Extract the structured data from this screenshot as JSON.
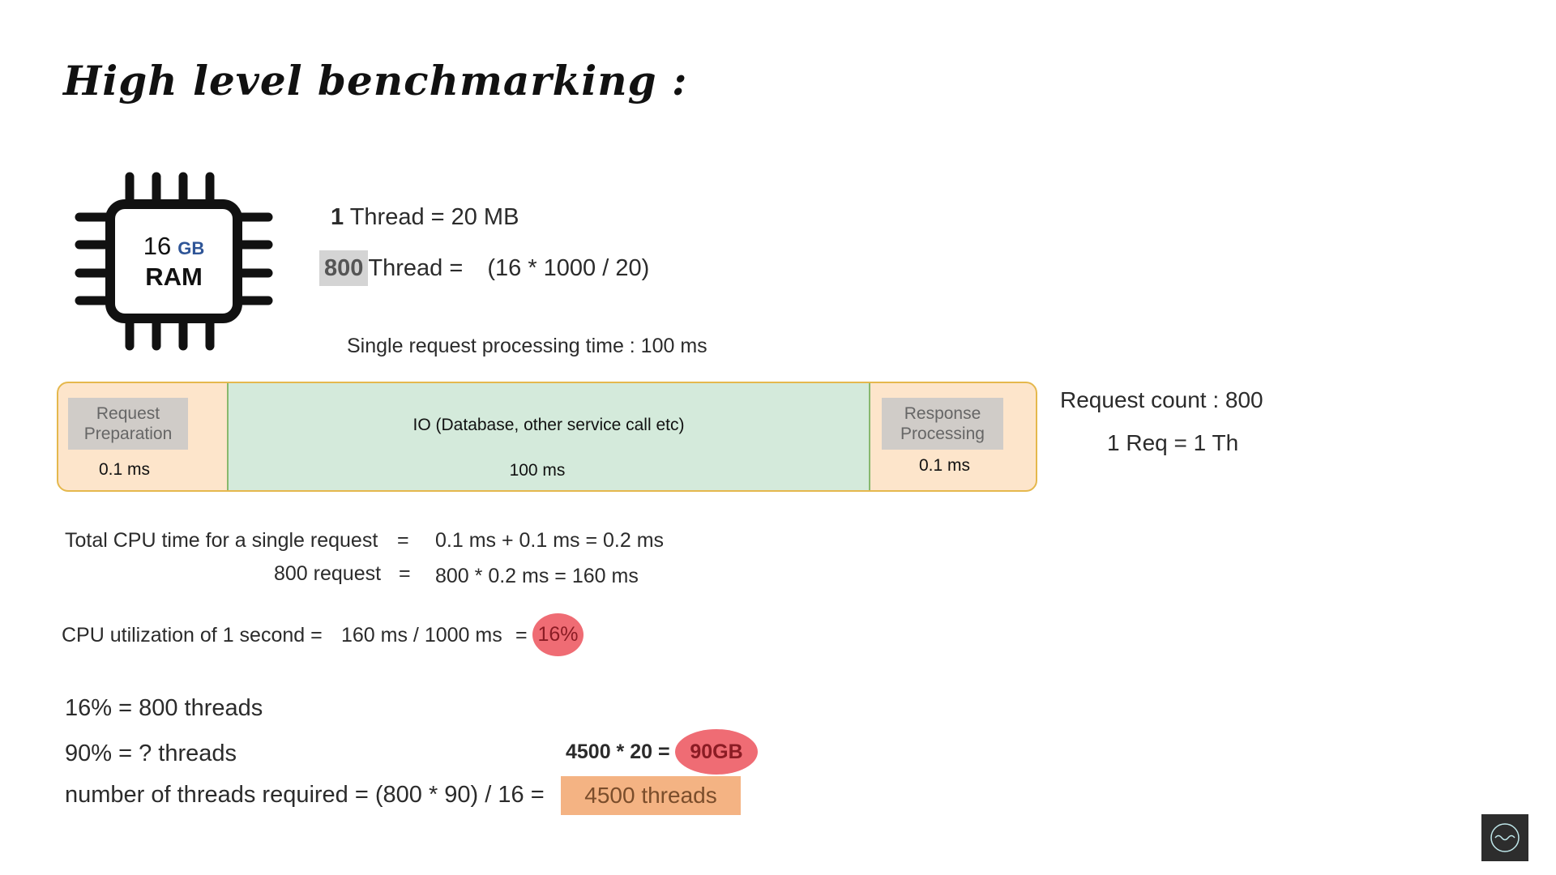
{
  "title": "High level benchmarking :",
  "chip": {
    "size": "16",
    "unit": "GB",
    "label": "RAM"
  },
  "thread_eq": {
    "count": "1",
    "text": "Thread = 20 MB"
  },
  "thread800": {
    "count": "800",
    "text": "Thread =",
    "formula": "(16 * 1000 / 20)"
  },
  "single_req_time": "Single request processing time : 100 ms",
  "timeline": {
    "prep_label": "Request Preparation",
    "prep_time": "0.1 ms",
    "io_label": "IO (Database, other service call etc)",
    "io_time": "100 ms",
    "resp_label": "Response Processing",
    "resp_time": "0.1 ms"
  },
  "request_count": "Request count : 800",
  "req_th": "1 Req = 1 Th",
  "cpu_total": {
    "label": "Total CPU time for a single request",
    "eq": "=",
    "value": "0.1 ms + 0.1 ms = 0.2 ms"
  },
  "cpu_800": {
    "label": "800 request",
    "eq": "=",
    "value": "800 * 0.2 ms = 160 ms"
  },
  "cpu_util": {
    "label": "CPU utilization of 1 second =",
    "value": "160 ms / 1000 ms",
    "eq": "=",
    "result": "16%"
  },
  "threads_16": "16% = 800 threads",
  "threads_90": "90% = ? threads",
  "mem_calc": {
    "text": "4500 * 20 =",
    "result": "90GB"
  },
  "threads_required": {
    "text": "number of threads required = (800 * 90) / 16 =",
    "result": "4500 threads"
  },
  "colors": {
    "accent_red": "#ef6c74",
    "accent_orange": "#f4b383",
    "io_green": "#d4eadb",
    "timeline_peach": "#fde5cb"
  }
}
